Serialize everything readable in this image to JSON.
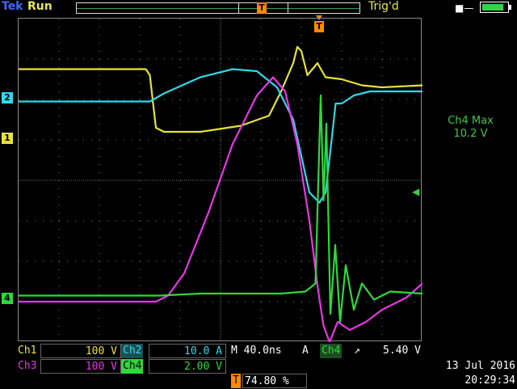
{
  "header": {
    "brand": "Tek",
    "run_state": "Run",
    "trigger_state": "Trig'd",
    "trigger_marker_label": "T"
  },
  "status": {
    "battery_level": 0.85,
    "power_icon": "plug-icon"
  },
  "colors": {
    "ch1": "#e8e23a",
    "ch2": "#2fd8ea",
    "ch3": "#e836e6",
    "ch4": "#2fd83b",
    "trigger": "#ff8a00",
    "grid": "#7d7d7d"
  },
  "channel_markers": {
    "ch1": "1",
    "ch2": "2",
    "ch4": "4"
  },
  "measurement": {
    "label": "Ch4 Max",
    "value": "10.2 V"
  },
  "readouts": {
    "ch1_label": "Ch1",
    "ch1_scale": "100 V",
    "ch2_label": "Ch2",
    "ch2_scale": "10.0 A",
    "ch3_label": "Ch3",
    "ch3_scale": "100 V",
    "ch4_label": "Ch4",
    "ch4_scale": "2.00 V",
    "timebase": "M 40.0ns",
    "trigger_mode": "A",
    "trigger_source": "Ch4",
    "trigger_slope": "↗",
    "trigger_level": "5.40 V",
    "trigger_position_label": "T",
    "trigger_position": "74.80 %",
    "date": "13 Jul 2016",
    "time": "20:29:34"
  },
  "chart_data": {
    "type": "line",
    "xlim": [
      0,
      10
    ],
    "ylim": [
      -4,
      4
    ],
    "grid": true,
    "series": [
      {
        "channel": "ch1",
        "x": [
          0,
          3.15,
          3.25,
          3.4,
          3.6,
          4.5,
          5.5,
          6.2,
          6.5,
          6.8,
          6.9,
          7.0,
          7.15,
          7.4,
          7.6,
          8.0,
          8.5,
          9.0,
          10.0
        ],
        "y": [
          2.75,
          2.75,
          2.6,
          1.3,
          1.2,
          1.2,
          1.35,
          1.6,
          2.2,
          2.9,
          3.3,
          3.2,
          2.6,
          2.9,
          2.55,
          2.5,
          2.35,
          2.3,
          2.35
        ]
      },
      {
        "channel": "ch2",
        "x": [
          0,
          3.25,
          3.6,
          4.5,
          5.3,
          5.9,
          6.4,
          6.8,
          7.0,
          7.2,
          7.45,
          7.6,
          7.75,
          7.85,
          8.0,
          8.3,
          8.7,
          9.2,
          10.0
        ],
        "y": [
          1.95,
          1.95,
          2.15,
          2.55,
          2.75,
          2.7,
          2.3,
          1.5,
          0.6,
          -0.3,
          -0.55,
          -0.3,
          1.0,
          1.9,
          1.9,
          2.1,
          2.2,
          2.2,
          2.2
        ]
      },
      {
        "channel": "ch3",
        "x": [
          0,
          3.4,
          3.7,
          4.1,
          4.7,
          5.3,
          5.9,
          6.3,
          6.6,
          6.9,
          7.2,
          7.4,
          7.55,
          7.7,
          7.9,
          8.2,
          8.6,
          9.0,
          9.6,
          10.0
        ],
        "y": [
          -3.0,
          -3.0,
          -2.85,
          -2.3,
          -0.8,
          0.9,
          2.1,
          2.55,
          2.2,
          0.9,
          -1.0,
          -2.6,
          -3.6,
          -4.0,
          -3.5,
          -3.7,
          -3.5,
          -3.2,
          -2.9,
          -2.55
        ]
      },
      {
        "channel": "ch4",
        "x": [
          0,
          3.5,
          4.5,
          6.5,
          7.1,
          7.35,
          7.48,
          7.55,
          7.62,
          7.72,
          7.84,
          7.96,
          8.1,
          8.3,
          8.5,
          8.8,
          9.2,
          10.0
        ],
        "y": [
          -2.85,
          -2.85,
          -2.8,
          -2.8,
          -2.75,
          -2.55,
          2.1,
          -0.5,
          1.4,
          -3.3,
          -1.6,
          -3.5,
          -2.1,
          -3.2,
          -2.55,
          -2.95,
          -2.75,
          -2.8
        ]
      }
    ]
  }
}
